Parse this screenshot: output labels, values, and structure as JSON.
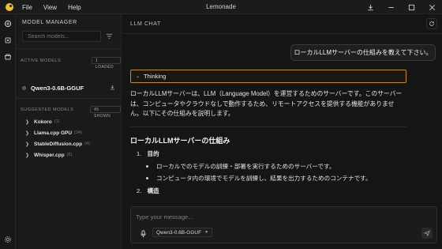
{
  "window": {
    "title": "Lemonade",
    "menu": [
      "File",
      "View",
      "Help"
    ],
    "controls": {
      "download_icon": "download-icon",
      "minimize_icon": "minimize-icon",
      "maximize_icon": "maximize-icon",
      "close_icon": "close-icon"
    }
  },
  "rail": {
    "items": [
      {
        "icon": "lemon-icon",
        "label": "chat"
      },
      {
        "icon": "cpu-icon",
        "label": "models"
      },
      {
        "icon": "store-icon",
        "label": "marketplace"
      }
    ],
    "settings_icon": "gear-icon"
  },
  "manager": {
    "title": "MODEL MANAGER",
    "search_placeholder": "Search models...",
    "active_label": "ACTIVE MODELS",
    "active_badge": "1 LOADED",
    "active_models": [
      {
        "name": "Qwen3-0.6B-GGUF"
      }
    ],
    "suggested_label": "SUGGESTED MODELS",
    "suggested_badge": "45 SHOWN",
    "suggested": [
      {
        "name": "Kokoro",
        "count": "(1)"
      },
      {
        "name": "Llama.cpp GPU",
        "count": "(34)"
      },
      {
        "name": "StableDiffusion.cpp",
        "count": "(4)"
      },
      {
        "name": "Whisper.cpp",
        "count": "(6)"
      }
    ]
  },
  "chat": {
    "title": "LLM CHAT",
    "user_message": "ローカルLLMサーバーの仕組みを教えて下さい。",
    "thinking_label": "Thinking",
    "reply_lines": [
      "ローカルLLMサーバーは、LLM（Language Model）を運営するためのサーバーです。このサーバー",
      "は、コンピュータやクラウドなしで動作するため、リモートアクセスを提供する機能がありませ",
      "ん。以下にその仕組みを説明します。"
    ],
    "heading": "ローカルLLMサーバーの仕組み",
    "list": [
      {
        "num": "1.",
        "title": "目的",
        "bullets": [
          "ローカルでのモデルの訓練・部署を実行するためのサーバーです。",
          "コンピュータ内の環境でモデルを訓練し、結果を出力するためのコンテナです。"
        ]
      },
      {
        "num": "2.",
        "title": "構造",
        "bullets": []
      }
    ],
    "composer_placeholder": "Type your message...",
    "selected_model": "Qwen3-0.6B-GGUF",
    "accent_color": "#c08a2a"
  }
}
